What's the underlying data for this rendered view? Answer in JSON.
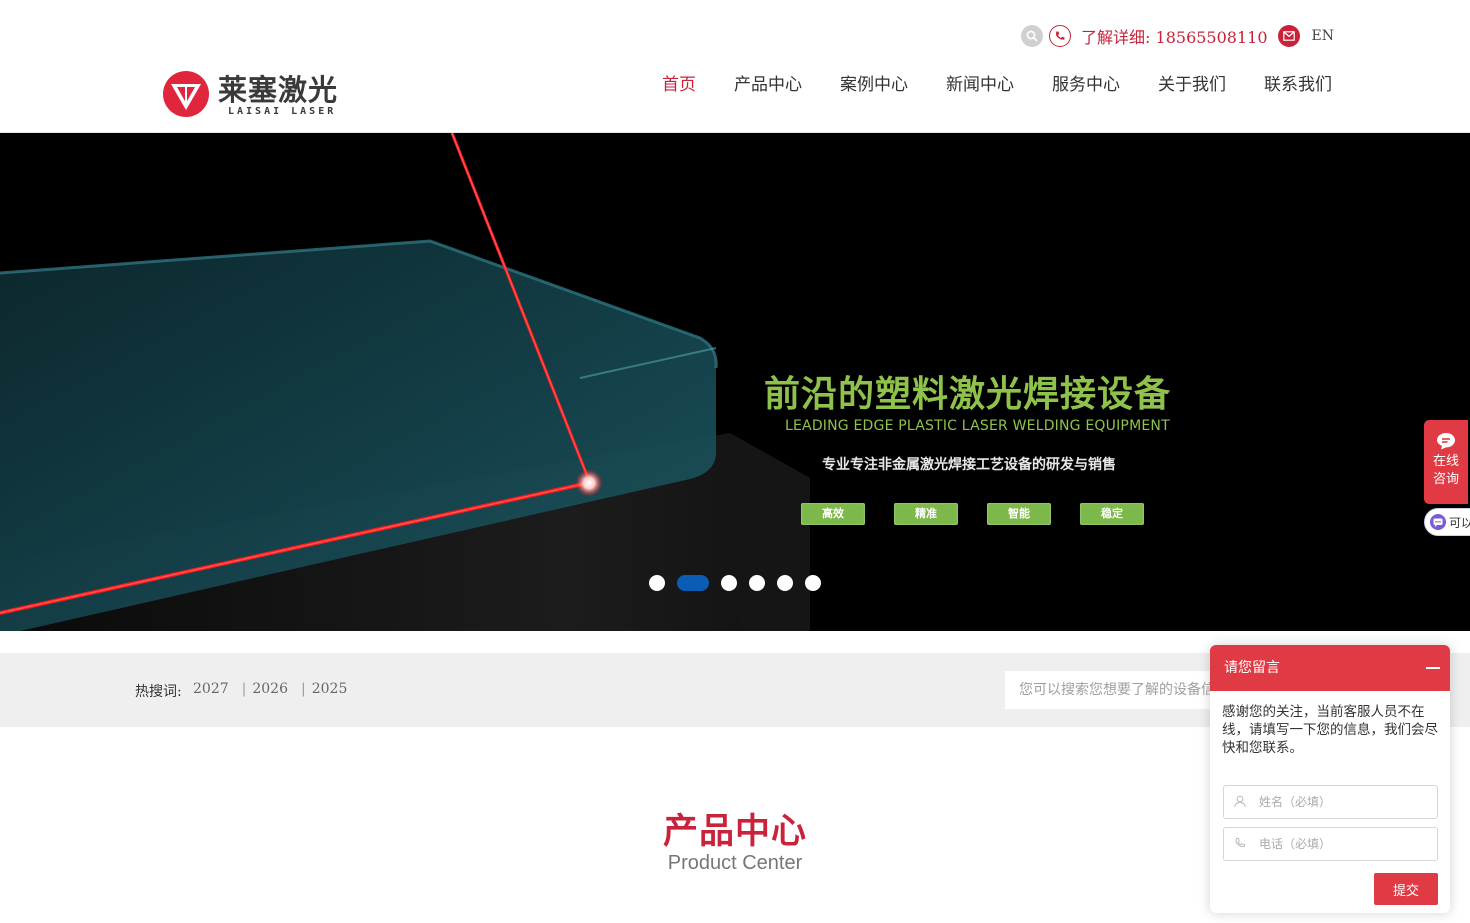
{
  "logo": {
    "cn": "莱塞激光",
    "en": "LAISAI LASER",
    "brand_color": "#e0263c"
  },
  "topbar": {
    "phone_label": "了解详细: 18565508110",
    "lang": "EN"
  },
  "nav": [
    "首页",
    "产品中心",
    "案例中心",
    "新闻中心",
    "服务中心",
    "关于我们",
    "联系我们"
  ],
  "nav_active_index": 0,
  "banner": {
    "title": "前沿的塑料激光焊接设备",
    "subtitle_en": "LEADING EDGE PLASTIC LASER WELDING EQUIPMENT",
    "subtitle_cn": "专业专注非金属激光焊接工艺设备的研发与销售",
    "tags": [
      "高效",
      "精准",
      "智能",
      "稳定"
    ],
    "slide_count": 6,
    "active_slide_index": 1,
    "title_color": "#8fc24a"
  },
  "hot": {
    "label": "热搜词:",
    "words": [
      "2027",
      "2026",
      "2025"
    ],
    "search_placeholder": "您可以搜索您想要了解的设备信息"
  },
  "section": {
    "title_cn": "产品中心",
    "title_en": "Product Center"
  },
  "side": {
    "consult_label": "在线咨询",
    "pill_text": "可以"
  },
  "message_panel": {
    "title": "请您留言",
    "intro": "感谢您的关注，当前客服人员不在线，请填写一下您的信息，我们会尽快和您联系。",
    "name_placeholder": "姓名（必填）",
    "phone_placeholder": "电话（必填）",
    "submit": "提交"
  }
}
